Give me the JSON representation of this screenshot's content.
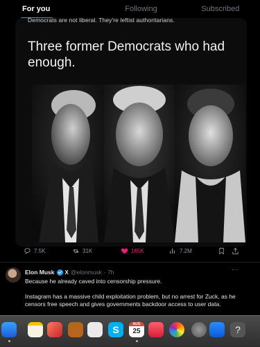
{
  "tabs": {
    "for_you": "For you",
    "following": "Following",
    "subscribed": "Subscribed"
  },
  "quoted_post": {
    "cut_text": "Democrats are not liberal. They're leftist authoritarians.",
    "headline": "Three former Democrats who had enough."
  },
  "actions": {
    "replies": "7.5K",
    "reposts": "31K",
    "likes": "165K",
    "views": "7.2M"
  },
  "reply": {
    "name": "Elon Musk",
    "handle": "@elonmusk",
    "time": "· 7h",
    "x_badge": "X",
    "more": "···",
    "line1": "Because he already caved into censorship pressure.",
    "paragraph": "Instagram has a massive child exploitation problem, but no arrest for Zuck, as he censors free speech and gives governments backdoor access to user data."
  },
  "dock": {
    "calendar_month": "AUG",
    "calendar_day": "25",
    "help_symbol": "?"
  },
  "colors": {
    "accent": "#1d9bf0",
    "like": "#f91880",
    "background": "#000000"
  }
}
